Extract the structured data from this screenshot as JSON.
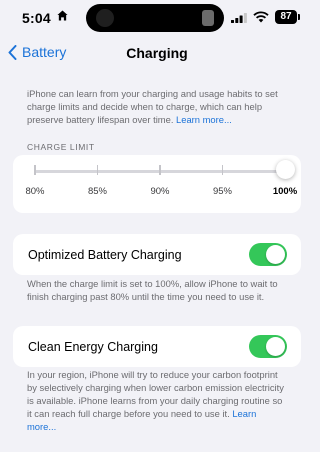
{
  "status_bar": {
    "time": "5:04",
    "battery_level": "87"
  },
  "nav": {
    "back_label": "Battery",
    "title": "Charging"
  },
  "intro": {
    "text": "iPhone can learn from your charging and usage habits to set charge limits and decide when to charge, which can help preserve battery lifespan over time.",
    "link": "Learn more..."
  },
  "charge_limit": {
    "section_label": "CHARGE LIMIT",
    "ticks": [
      "80%",
      "85%",
      "90%",
      "95%",
      "100%"
    ],
    "selected": "100%",
    "level_fraction": 1.0
  },
  "optimized": {
    "label": "Optimized Battery Charging",
    "enabled": true,
    "footer": "When the charge limit is set to 100%, allow iPhone to wait to finish charging past 80% until the time you need to use it."
  },
  "clean_energy": {
    "label": "Clean Energy Charging",
    "enabled": true,
    "footer": "In your region, iPhone will try to reduce your carbon footprint by selectively charging when lower carbon emission electricity is available. iPhone learns from your daily charging routine so it can reach full charge before you need to use it.",
    "link": "Learn more..."
  },
  "colors": {
    "accent": "#1c73d8",
    "toggle_on": "#34c759",
    "background": "#f2f2f7"
  },
  "icons": [
    "home-icon",
    "signal-icon",
    "wifi-icon",
    "battery-icon",
    "chevron-left-icon"
  ]
}
